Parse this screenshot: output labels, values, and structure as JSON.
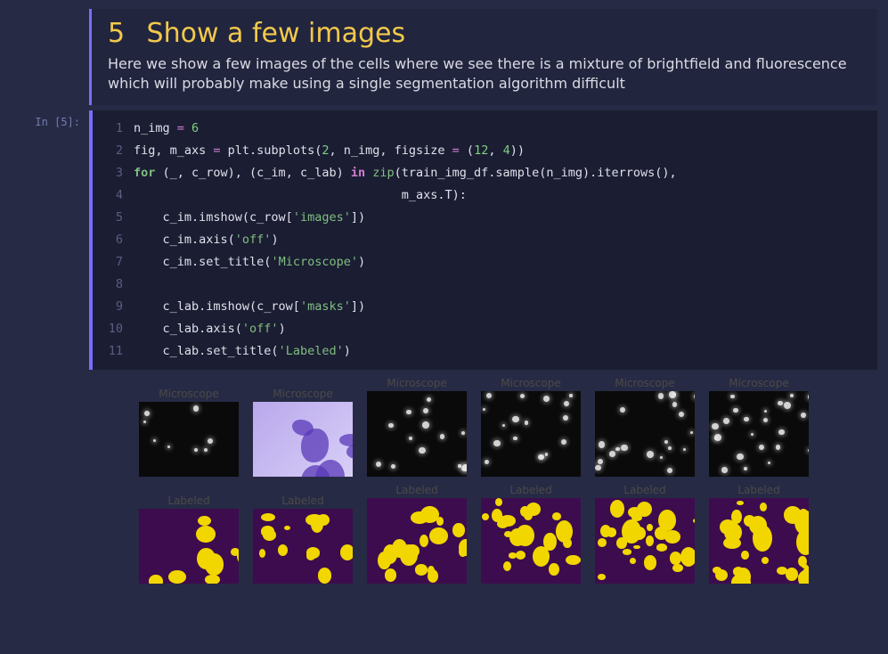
{
  "markdown": {
    "section_number": "5",
    "title_text": "Show a few images",
    "body": "Here we show a few images of the cells where we see there is a mixture of brightfield and fluorescence which will probably make using a single segmentation algorithm difficult"
  },
  "code_cell": {
    "prompt": "In [5]:",
    "lines": [
      {
        "n": "1",
        "segs": [
          [
            "",
            "n_img "
          ],
          [
            "op",
            "= "
          ],
          [
            "num",
            "6"
          ]
        ]
      },
      {
        "n": "2",
        "segs": [
          [
            "",
            "fig, m_axs "
          ],
          [
            "op",
            "= "
          ],
          [
            "",
            "plt.subplots("
          ],
          [
            "num",
            "2"
          ],
          [
            "",
            ", n_img, figsize "
          ],
          [
            "op",
            "= "
          ],
          [
            "",
            "("
          ],
          [
            "num",
            "12"
          ],
          [
            "",
            ", "
          ],
          [
            "num",
            "4"
          ],
          [
            "",
            "))"
          ]
        ]
      },
      {
        "n": "3",
        "segs": [
          [
            "kw",
            "for"
          ],
          [
            "",
            " (_, c_row), (c_im, c_lab) "
          ],
          [
            "in",
            "in"
          ],
          [
            "",
            " "
          ],
          [
            "bi",
            "zip"
          ],
          [
            "",
            "(train_img_df.sample(n_img).iterrows(),"
          ]
        ]
      },
      {
        "n": "4",
        "segs": [
          [
            "",
            "                                     m_axs.T):"
          ]
        ]
      },
      {
        "n": "5",
        "segs": [
          [
            "",
            "    c_im.imshow(c_row["
          ],
          [
            "str",
            "'images'"
          ],
          [
            "",
            "])"
          ]
        ]
      },
      {
        "n": "6",
        "segs": [
          [
            "",
            "    c_im.axis("
          ],
          [
            "str",
            "'off'"
          ],
          [
            "",
            ")"
          ]
        ]
      },
      {
        "n": "7",
        "segs": [
          [
            "",
            "    c_im.set_title("
          ],
          [
            "str",
            "'Microscope'"
          ],
          [
            "",
            ")"
          ]
        ]
      },
      {
        "n": "8",
        "segs": [
          [
            "",
            ""
          ]
        ]
      },
      {
        "n": "9",
        "segs": [
          [
            "",
            "    c_lab.imshow(c_row["
          ],
          [
            "str",
            "'masks'"
          ],
          [
            "",
            "])"
          ]
        ]
      },
      {
        "n": "10",
        "segs": [
          [
            "",
            "    c_lab.axis("
          ],
          [
            "str",
            "'off'"
          ],
          [
            "",
            ")"
          ]
        ]
      },
      {
        "n": "11",
        "segs": [
          [
            "",
            "    c_lab.set_title("
          ],
          [
            "str",
            "'Labeled'"
          ],
          [
            "",
            ")"
          ]
        ]
      }
    ]
  },
  "output": {
    "top_titles": [
      "Microscope",
      "Microscope",
      "Microscope",
      "Microscope",
      "Microscope",
      "Microscope"
    ],
    "bottom_titles": [
      "Labeled",
      "Labeled",
      "Labeled",
      "Labeled",
      "Labeled",
      "Labeled"
    ],
    "top_kinds": [
      "fluor",
      "bf",
      "fluor",
      "fluor",
      "fluor",
      "fluor"
    ]
  },
  "colors": {
    "page_bg": "#272a44",
    "cell_bg": "#1b1d33",
    "accent": "#7a6cff",
    "heading": "#f2c94c",
    "mask_bg": "#3d0c4e",
    "mask_fg": "#f2d600"
  }
}
